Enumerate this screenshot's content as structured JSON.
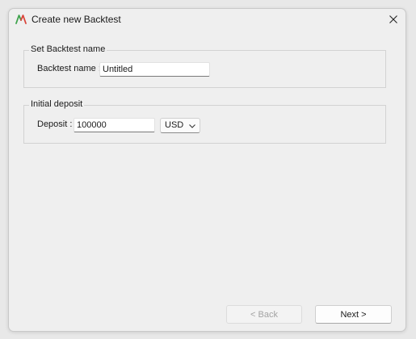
{
  "window": {
    "title": "Create new Backtest",
    "app_icon": "app-logo-icon",
    "close_icon": "close-icon"
  },
  "backtest_name_group": {
    "legend": "Set Backtest name",
    "label": "Backtest name :",
    "value": "Untitled"
  },
  "deposit_group": {
    "legend": "Initial deposit",
    "label": "Deposit :",
    "value": "100000",
    "currency": {
      "selected": "USD",
      "icon": "chevron-down-icon"
    }
  },
  "footer": {
    "back_label": "< Back",
    "next_label": "Next >"
  },
  "colors": {
    "logo_green": "#3fa34d",
    "logo_red": "#d9443a"
  }
}
